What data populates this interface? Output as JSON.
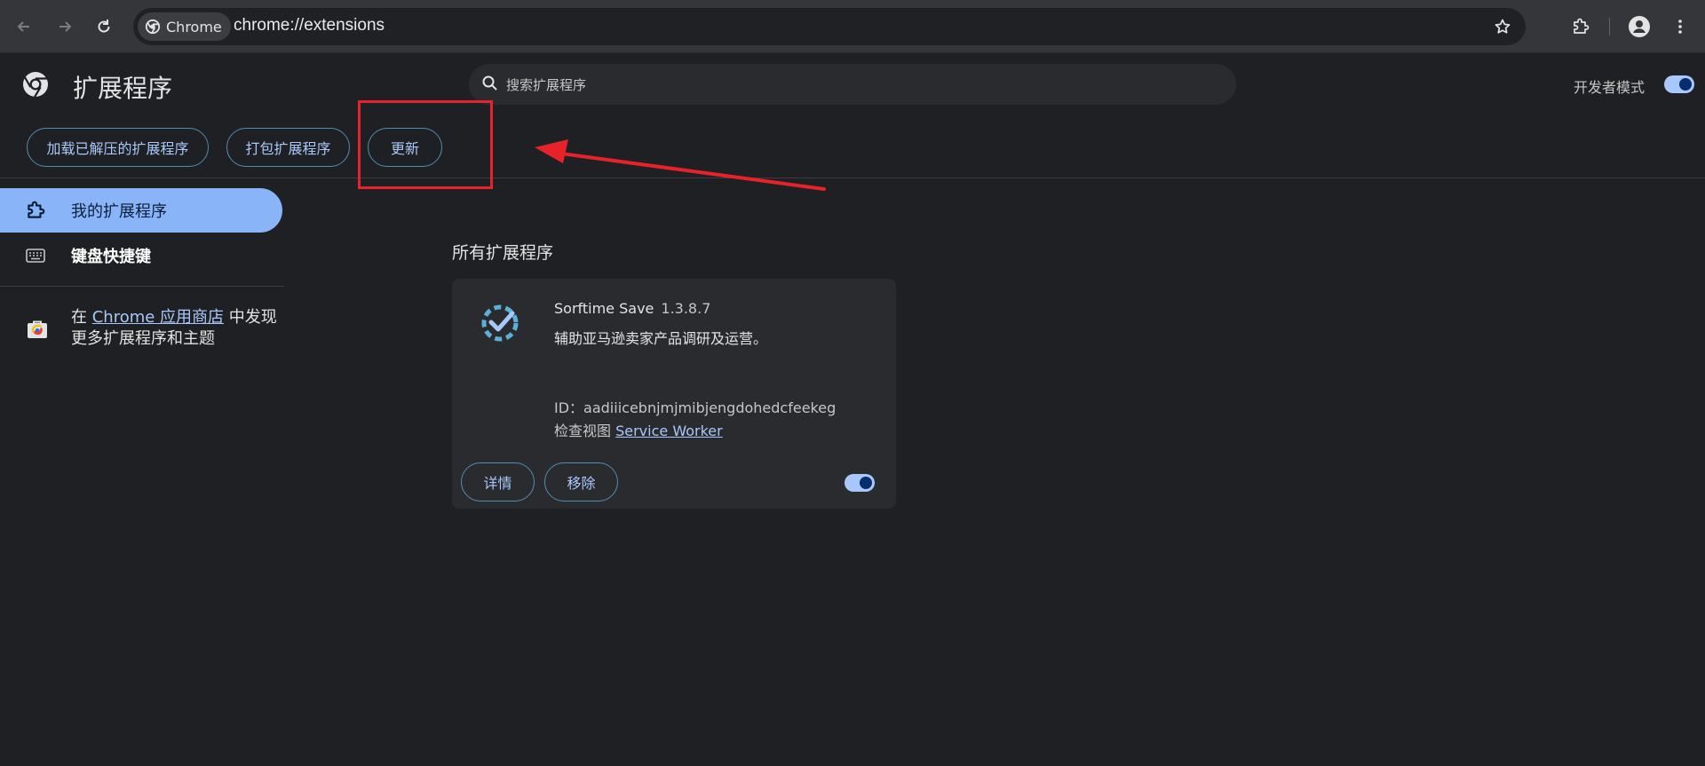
{
  "browser": {
    "site_chip": "Chrome",
    "url": "chrome://extensions"
  },
  "header": {
    "title": "扩展程序",
    "search_placeholder": "搜索扩展程序",
    "developer_mode_label": "开发者模式",
    "developer_mode_on": true
  },
  "actions": {
    "load_unpacked": "加载已解压的扩展程序",
    "pack": "打包扩展程序",
    "update": "更新"
  },
  "sidebar": {
    "my_extensions": "我的扩展程序",
    "shortcuts": "键盘快捷键",
    "store_prefix": "在 ",
    "store_link": "Chrome 应用商店",
    "store_suffix": " 中发现",
    "store_line2": "更多扩展程序和主题"
  },
  "main": {
    "section_title": "所有扩展程序",
    "extension": {
      "name": "Sorftime Save",
      "version": "1.3.8.7",
      "description": "辅助亚马逊卖家产品调研及运营。",
      "id_line": "ID：aadiiicebnjmjmibjengdohedcfeekeg",
      "inspect_label": "检查视图 ",
      "inspect_link": "Service Worker",
      "details_button": "详情",
      "remove_button": "移除",
      "enabled": true
    }
  },
  "colors": {
    "accent": "#a8c7fa",
    "annotation": "#e8222a",
    "active_nav": "#8ab4f8"
  }
}
